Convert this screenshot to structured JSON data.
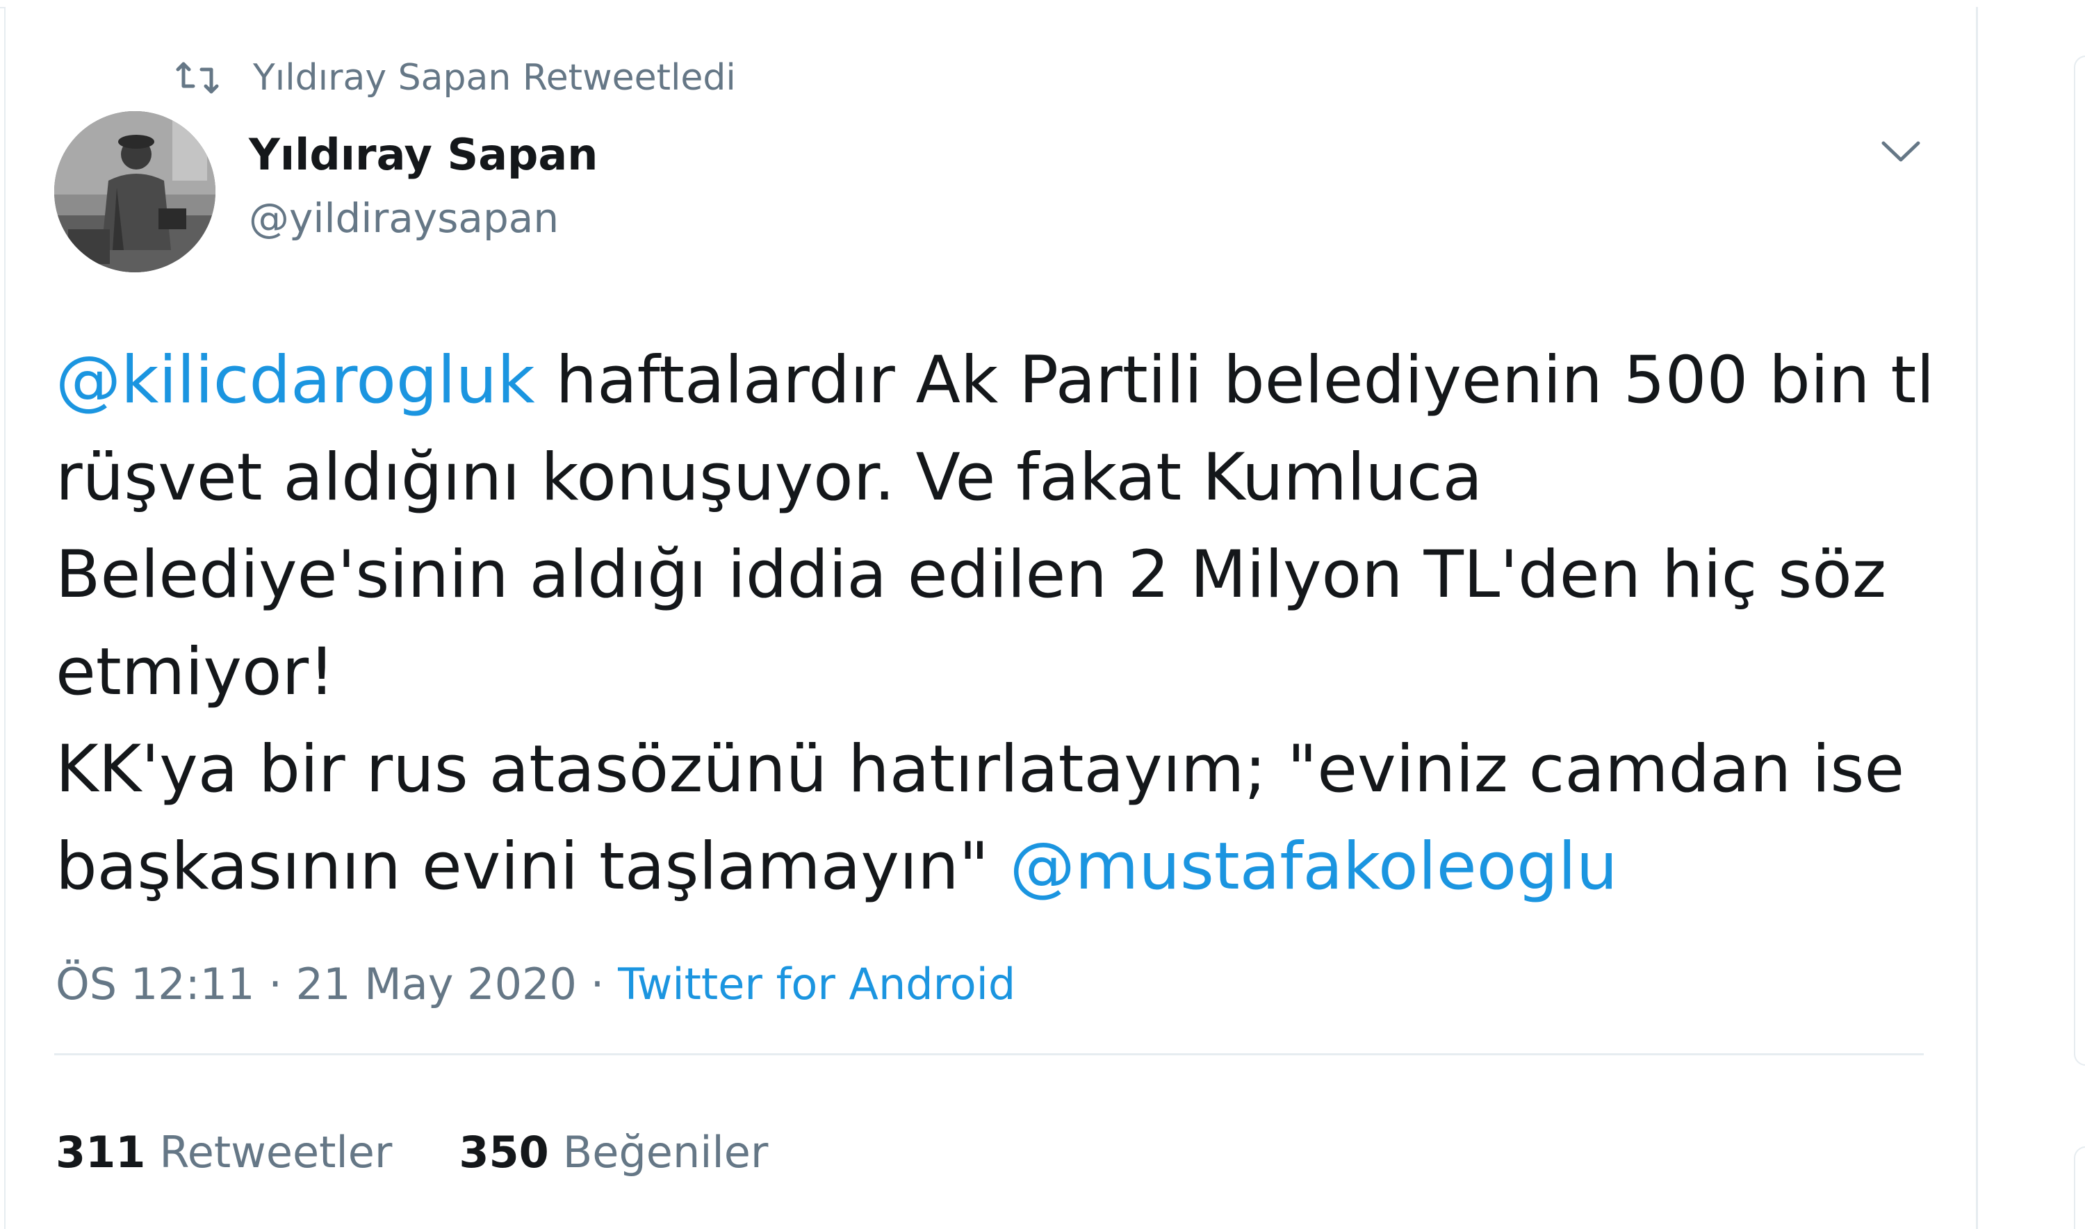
{
  "retweet_context": {
    "icon": "retweet-icon",
    "text": "Yıldıray Sapan Retweetledi"
  },
  "author": {
    "name": "Yıldıray Sapan",
    "handle": "@yildiraysapan",
    "avatar_icon": "avatar"
  },
  "tweet": {
    "mention_1": "@kilicdarogluk",
    "text_1": " haftalardır Ak Partili belediyenin 500 bin tl rüşvet aldığını konuşuyor. Ve fakat Kumluca Belediye'sinin aldığı iddia edilen 2 Milyon TL'den hiç söz etmiyor!\nKK'ya bir rus atasözünü hatırlatayım; \"eviniz camdan ise başkasının evini taşlamayın\" ",
    "mention_2": "@mustafakoleoglu"
  },
  "meta": {
    "time": "ÖS 12:11",
    "separator": " · ",
    "date": "21 May 2020",
    "source": "Twitter for Android"
  },
  "stats": {
    "retweets_count": "311",
    "retweets_label": "Retweetler",
    "likes_count": "350",
    "likes_label": "Beğeniler"
  },
  "colors": {
    "link": "#1b95e0",
    "secondary_text": "#657786",
    "primary_text": "#14171a",
    "border": "#e6ecf0"
  }
}
